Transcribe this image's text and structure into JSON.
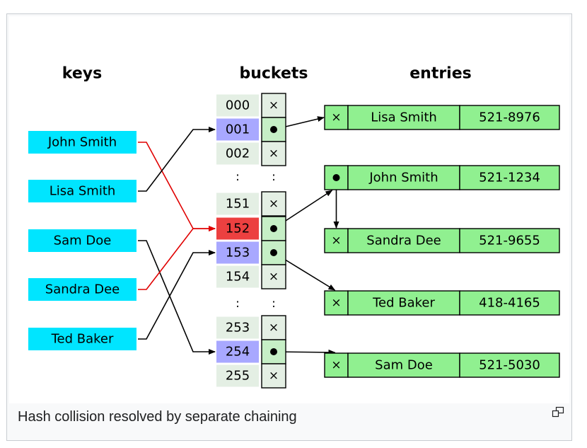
{
  "headers": {
    "keys": "keys",
    "buckets": "buckets",
    "entries": "entries"
  },
  "keys": [
    "John Smith",
    "Lisa Smith",
    "Sam Doe",
    "Sandra Dee",
    "Ted Baker"
  ],
  "buckets": [
    {
      "index": "000",
      "state": "empty",
      "slot": "×"
    },
    {
      "index": "001",
      "state": "used",
      "slot": "pointer"
    },
    {
      "index": "002",
      "state": "empty",
      "slot": "×"
    },
    {
      "index": ":",
      "state": "ellipsis",
      "slot": ":"
    },
    {
      "index": "151",
      "state": "empty",
      "slot": "×"
    },
    {
      "index": "152",
      "state": "collision",
      "slot": "pointer"
    },
    {
      "index": "153",
      "state": "used",
      "slot": "pointer"
    },
    {
      "index": "154",
      "state": "empty",
      "slot": "×"
    },
    {
      "index": ":",
      "state": "ellipsis",
      "slot": ":"
    },
    {
      "index": "253",
      "state": "empty",
      "slot": "×"
    },
    {
      "index": "254",
      "state": "used",
      "slot": "pointer"
    },
    {
      "index": "255",
      "state": "empty",
      "slot": "×"
    }
  ],
  "entries": [
    {
      "next": "×",
      "name": "Lisa Smith",
      "phone": "521-8976"
    },
    {
      "next": "pointer",
      "name": "John Smith",
      "phone": "521-1234"
    },
    {
      "next": "×",
      "name": "Sandra Dee",
      "phone": "521-9655"
    },
    {
      "next": "×",
      "name": "Ted Baker",
      "phone": "418-4165"
    },
    {
      "next": "×",
      "name": "Sam Doe",
      "phone": "521-5030"
    }
  ],
  "hash_links": [
    {
      "key": "John Smith",
      "bucket": "152",
      "collision": true
    },
    {
      "key": "Lisa Smith",
      "bucket": "001",
      "collision": false
    },
    {
      "key": "Sam Doe",
      "bucket": "254",
      "collision": false
    },
    {
      "key": "Sandra Dee",
      "bucket": "152",
      "collision": true
    },
    {
      "key": "Ted Baker",
      "bucket": "153",
      "collision": false
    }
  ],
  "chain_links": [
    {
      "from": "001",
      "to": "Lisa Smith"
    },
    {
      "from": "152",
      "to": "John Smith"
    },
    {
      "from": "John Smith",
      "to": "Sandra Dee"
    },
    {
      "from": "153",
      "to": "Ted Baker"
    },
    {
      "from": "254",
      "to": "Sam Doe"
    }
  ],
  "colors": {
    "key_fill": "#00e5ff",
    "bucket_empty": "#e4efe4",
    "bucket_used": "#a8a8ff",
    "bucket_collision": "#ec4040",
    "slot_fill": "#c6efc6",
    "entry_fill": "#90f090",
    "collision_line": "#e00000",
    "line": "#000000"
  },
  "caption": "Hash collision resolved by separate chaining",
  "enlarge_icon": "enlarge-icon"
}
